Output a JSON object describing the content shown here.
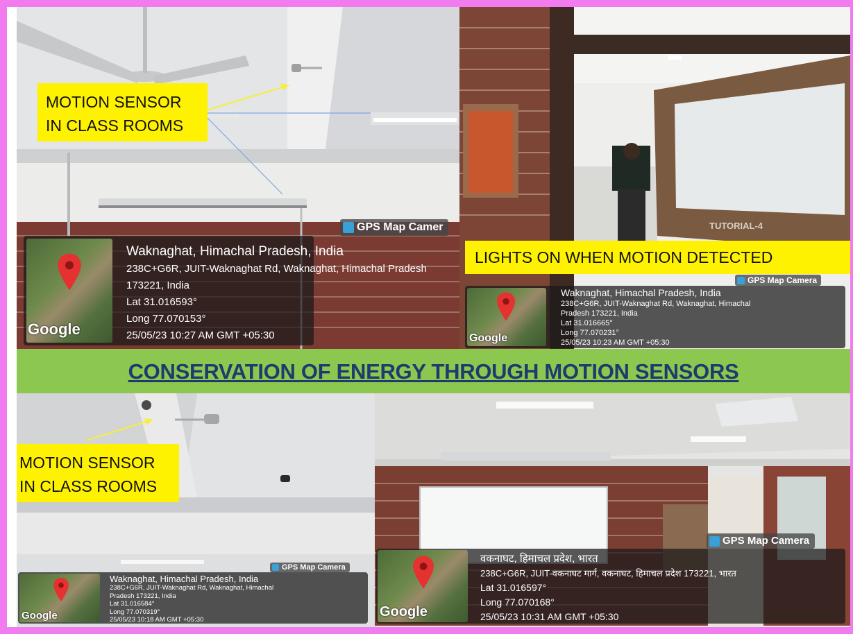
{
  "banner": {
    "title": "CONSERVATION OF ENERGY THROUGH MOTION SENSORS"
  },
  "panels": {
    "top_left": {
      "callout": [
        "MOTION SENSOR",
        "IN CLASS ROOMS"
      ],
      "gps_app": "GPS Map Camer",
      "location": "Waknaghat, Himachal Pradesh, India",
      "address": [
        "238C+G6R, JUIT-Waknaghat Rd, Waknaghat, Himachal Pradesh",
        "173221, India"
      ],
      "lat": "Lat 31.016593°",
      "long": "Long 77.070153°",
      "timestamp": "25/05/23 10:27 AM GMT +05:30",
      "map_logo": "Google"
    },
    "top_right": {
      "callout": [
        "LIGHTS ON WHEN MOTION DETECTED"
      ],
      "door_sign": "TUTORIAL-4",
      "gps_app": "GPS Map Camera",
      "location": "Waknaghat, Himachal Pradesh, India",
      "address": [
        "238C+G6R, JUIT-Waknaghat Rd, Waknaghat, Himachal",
        "Pradesh 173221, India"
      ],
      "lat": "Lat 31.016665°",
      "long": "Long 77.070231°",
      "timestamp": "25/05/23 10:23 AM GMT +05:30",
      "map_logo": "Google"
    },
    "bottom_left": {
      "callout": [
        "MOTION SENSOR",
        "IN CLASS ROOMS"
      ],
      "gps_app": "GPS Map Camera",
      "location": "Waknaghat, Himachal Pradesh, India",
      "address": [
        "238C+G6R, JUIT-Waknaghat Rd, Waknaghat, Himachal",
        "Pradesh 173221, India"
      ],
      "lat": "Lat 31.016584°",
      "long": "Long 77.070319°",
      "timestamp": "25/05/23 10:18 AM GMT +05:30",
      "map_logo": "Google"
    },
    "bottom_right": {
      "gps_app": "GPS Map Camera",
      "location": "वकनाघट, हिमाचल प्रदेश, भारत",
      "address": [
        "238C+G6R, JUIT-वकनाघट मार्ग, वकनाघट, हिमाचल प्रदेश 173221, भारत"
      ],
      "lat": "Lat 31.016597°",
      "long": "Long 77.070168°",
      "timestamp": "25/05/23 10:31 AM GMT +05:30",
      "map_logo": "Google"
    }
  },
  "colors": {
    "frame": "#f27bf0",
    "callout": "#fff200",
    "banner": "#8cc850",
    "banner_text": "#1f3a6e",
    "arrow": "#f5ef3a",
    "pin": "#e5312f"
  }
}
